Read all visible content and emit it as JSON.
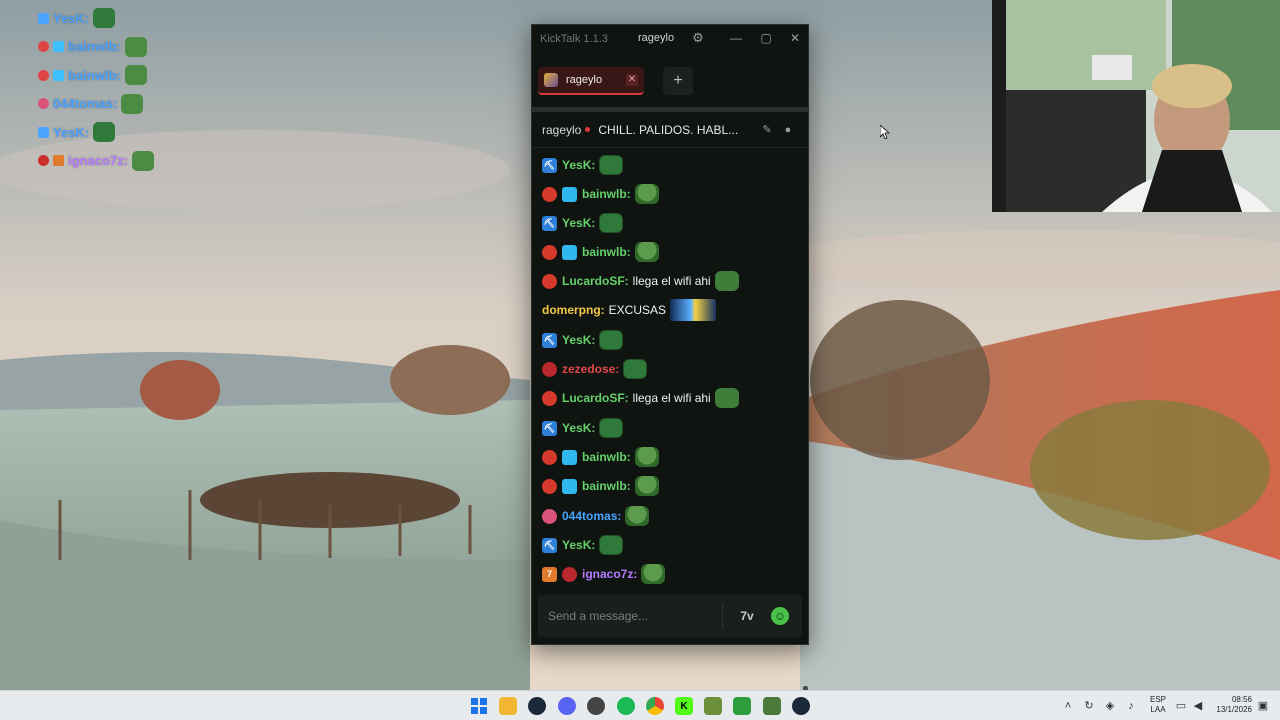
{
  "overlay": {
    "lines": [
      {
        "user": "YesK:",
        "color": "#4aa3ff"
      },
      {
        "user": "bainwlb:",
        "color": "#4aa3ff"
      },
      {
        "user": "bainwlb:",
        "color": "#4aa3ff"
      },
      {
        "user": "044tomas:",
        "color": "#4aa3ff"
      },
      {
        "user": "YesK:",
        "color": "#4aa3ff"
      },
      {
        "user": "ignaco7z:",
        "color": "#b57bff"
      }
    ]
  },
  "kicktalk": {
    "app_version": "KickTalk 1.1.3",
    "titlebar_user": "rageylo",
    "window_buttons": {
      "minimize": "—",
      "maximize": "▢",
      "close": "✕"
    },
    "tab": {
      "label": "rageylo",
      "close": "✕"
    },
    "add_tab": "+",
    "stream": {
      "channel": "rageylo",
      "title": "CHILL. PALIDOS. HABL..."
    },
    "messages": [
      {
        "user": "YesK:",
        "color": "#66d16a",
        "text": "",
        "badges": [
          "blue-pick"
        ],
        "emote": "block"
      },
      {
        "user": "bainwlb:",
        "color": "#66d16a",
        "text": "",
        "badges": [
          "red-round",
          "cyan-cube"
        ],
        "emote": "pepe"
      },
      {
        "user": "YesK:",
        "color": "#66d16a",
        "text": "",
        "badges": [
          "blue-pick"
        ],
        "emote": "block"
      },
      {
        "user": "bainwlb:",
        "color": "#66d16a",
        "text": "",
        "badges": [
          "red-round",
          "cyan-cube"
        ],
        "emote": "pepe"
      },
      {
        "user": "LucardoSF:",
        "color": "#66d16a",
        "text": "llega el wifi ahi",
        "badges": [
          "red-round"
        ],
        "emote": "dark"
      },
      {
        "user": "domerpng:",
        "color": "#f2c94c",
        "text": "EXCUSAS",
        "badges": [],
        "emote": "car"
      },
      {
        "user": "YesK:",
        "color": "#66d16a",
        "text": "",
        "badges": [
          "blue-pick"
        ],
        "emote": "block"
      },
      {
        "user": "zezedose:",
        "color": "#e0474c",
        "text": "",
        "badges": [
          "red-skull"
        ],
        "emote": "block"
      },
      {
        "user": "LucardoSF:",
        "color": "#66d16a",
        "text": "llega el wifi ahi",
        "badges": [
          "red-round"
        ],
        "emote": "dark"
      },
      {
        "user": "YesK:",
        "color": "#66d16a",
        "text": "",
        "badges": [
          "blue-pick"
        ],
        "emote": "block"
      },
      {
        "user": "bainwlb:",
        "color": "#66d16a",
        "text": "",
        "badges": [
          "red-round",
          "cyan-cube"
        ],
        "emote": "pepe"
      },
      {
        "user": "bainwlb:",
        "color": "#66d16a",
        "text": "",
        "badges": [
          "red-round",
          "cyan-cube"
        ],
        "emote": "pepe"
      },
      {
        "user": "044tomas:",
        "color": "#4aa3ff",
        "text": "",
        "badges": [
          "pink-round"
        ],
        "emote": "pepe"
      },
      {
        "user": "YesK:",
        "color": "#66d16a",
        "text": "",
        "badges": [
          "blue-pick"
        ],
        "emote": "block"
      },
      {
        "user": "ignaco7z:",
        "color": "#b57bff",
        "text": "",
        "badges": [
          "orange-7tv",
          "red-skull"
        ],
        "emote": "pepe"
      }
    ],
    "input": {
      "placeholder": "Send a message...",
      "value": ""
    },
    "input_icons": {
      "seventv": "7v"
    }
  },
  "taskbar": {
    "lang_line1": "ESP",
    "lang_line2": "LAA",
    "time": "08:56",
    "date": "13/1/2026"
  }
}
